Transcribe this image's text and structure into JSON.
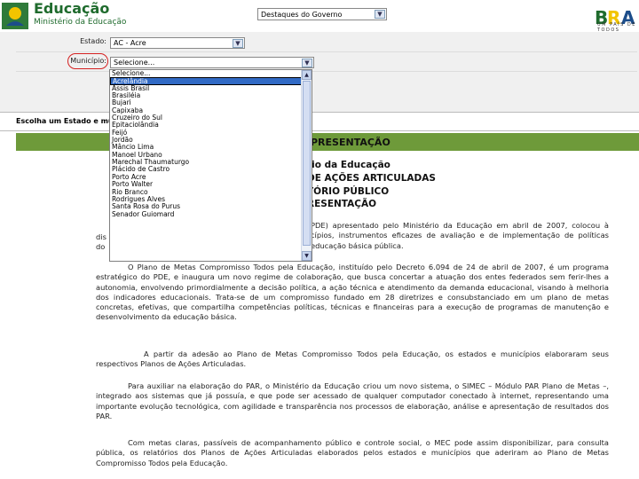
{
  "header": {
    "title": "Educação",
    "subtitle": "Ministério da Educação",
    "gov_select_value": "Destaques do Governo",
    "gov_logo_text": "UM PAÍS DE TODOS"
  },
  "form": {
    "estado_label": "Estado:",
    "estado_value": "AC - Acre",
    "municipio_label": "Município:",
    "municipio_value": "Selecione..."
  },
  "dropdown": {
    "options": [
      "Selecione...",
      "Acrelândia",
      "Assis Brasil",
      "Brasiléia",
      "Bujari",
      "Capixaba",
      "Cruzeiro do Sul",
      "Epitaciolândia",
      "Feijó",
      "Jordão",
      "Mâncio Lima",
      "Manoel Urbano",
      "Marechal Thaumaturgo",
      "Plácido de Castro",
      "Porto Acre",
      "Porto Walter",
      "Rio Branco",
      "Rodrigues Alves",
      "Santa Rosa do Purus",
      "Senador Guiomard"
    ],
    "selected": "Acrelândia"
  },
  "choose_text": "Escolha um Estado e mu",
  "section_title": "PRESENTAÇÃO",
  "doc": {
    "h1": "rio da Educação",
    "h2": "DE AÇÕES ARTICULADAS",
    "h3": "TÓRIO PÚBLICO",
    "h4": "RESENTAÇÃO",
    "left_fragment_1": "dis",
    "left_fragment_2": "do",
    "p1": "PDE) apresentado pelo Ministério da Educação em abril de 2007, colocou à cípios, instrumentos eficazes de avaliação e de implementação de políticas educação básica pública.",
    "p2": "O Plano de Metas Compromisso Todos pela Educação, instituído pelo Decreto 6.094 de 24 de abril de 2007, é um programa estratégico do PDE, e inaugura um novo regime de colaboração, que busca concertar a atuação dos entes federados sem ferir-lhes a autonomia, envolvendo primordialmente a decisão política, a ação técnica e atendimento da demanda educacional, visando à melhoria dos indicadores educacionais. Trata-se de um compromisso fundado em 28 diretrizes e consubstanciado em um plano de metas concretas, efetivas, que compartilha competências políticas, técnicas e financeiras para a execução de programas de manutenção e desenvolvimento da educação básica.",
    "p3": "A partir da adesão ao Plano de Metas Compromisso Todos pela Educação, os estados e municípios elaboraram seus respectivos Planos de Ações Articuladas.",
    "p4": "Para auxiliar na elaboração do PAR, o Ministério da Educação criou um novo sistema, o SIMEC – Módulo PAR Plano de Metas –, integrado aos sistemas que já possuía, e que pode ser acessado de qualquer computador conectado à internet, representando uma importante evolução tecnológica, com agilidade e transparência nos processos de elaboração, análise e apresentação de resultados dos PAR.",
    "p5": "Com metas claras, passíveis de acompanhamento público e controle social, o MEC pode assim disponibilizar, para consulta pública, os relatórios dos Planos de Ações Articuladas elaborados pelos estados e municípios que aderiram ao Plano de Metas Compromisso Todos pela Educação."
  }
}
